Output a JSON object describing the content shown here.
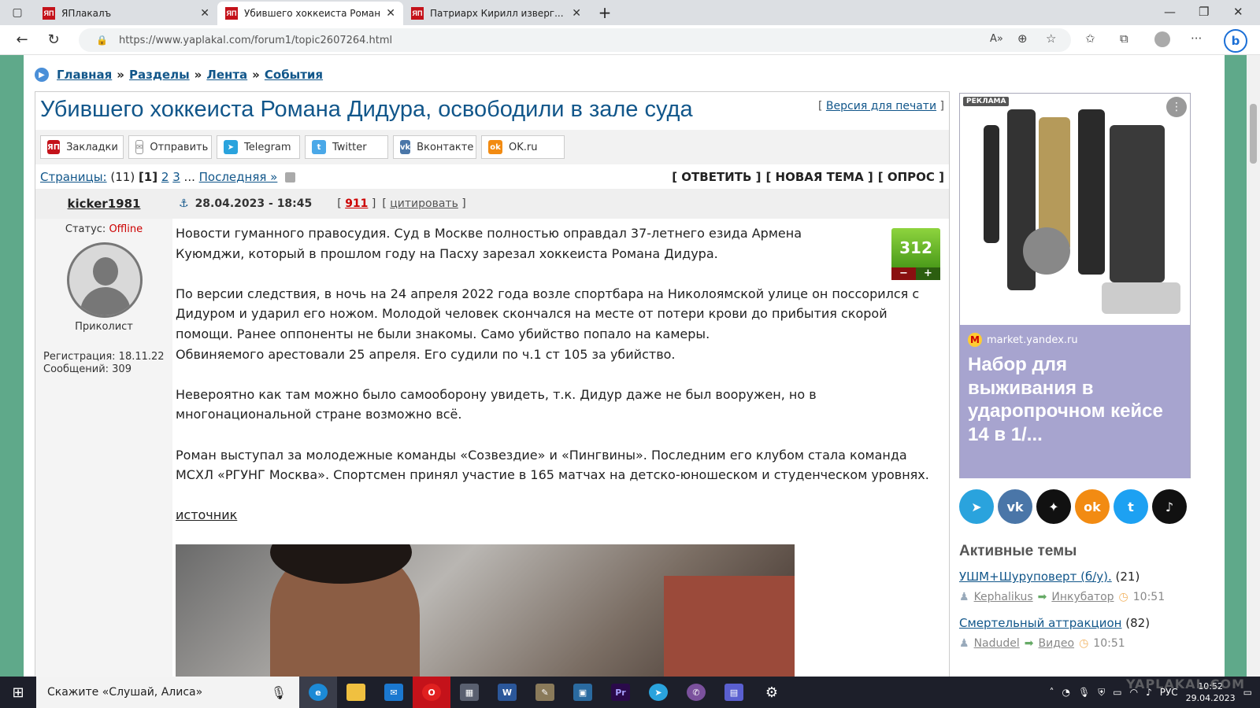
{
  "browser": {
    "tabs": [
      {
        "label": "ЯПлакалъ"
      },
      {
        "label": "Убившего хоккеиста Романа Ди"
      },
      {
        "label": "Патриарх Кирилл изверг... прот"
      }
    ],
    "url": "https://www.yaplakal.com/forum1/topic2607264.html"
  },
  "breadcrumbs": {
    "home": "Главная",
    "sections": "Разделы",
    "feed": "Лента",
    "events": "События",
    "sep": "»"
  },
  "topic": {
    "title": "Убившего хоккеиста Романа Дидура, освободили в зале суда",
    "print_version": "Версия для печати"
  },
  "share": {
    "bookmarks": "Закладки",
    "send": "Отправить",
    "telegram": "Telegram",
    "twitter": "Twitter",
    "vk": "Вконтакте",
    "ok": "OK.ru"
  },
  "pagination": {
    "label": "Страницы:",
    "count": "(11)",
    "current": "[1]",
    "p2": "2",
    "p3": "3",
    "ellipsis": "...",
    "last": "Последняя »"
  },
  "actions": {
    "reply": "[ ОТВЕТИТЬ ]",
    "new_topic": "[ НОВАЯ ТЕМА ]",
    "poll": "[ ОПРОС ]"
  },
  "post": {
    "author": "kicker1981",
    "datetime": "28.04.2023 - 18:45",
    "number": "911",
    "quote": "цитировать",
    "status_label": "Статус:",
    "status_value": "Offline",
    "rank": "Приколист",
    "registration": "Регистрация: 18.11.22",
    "messages": "Сообщений: 309",
    "rating": "312",
    "minus": "−",
    "plus": "+",
    "p1": "Новости гуманного правосудия. Суд в Москве полностью оправдал 37-летнего езида Армена Куюмджи, который в прошлом году на Пасху зарезал хоккеиста Романа Дидура.",
    "p2a": "По версии следствия, в ночь на 24 апреля 2022 года возле спортбара на Николоямской улице он поссорился с Дидуром и ударил его ножом. Молодой человек скончался на месте от потери крови до прибытия скорой помощи. Ранее оппоненты не были знакомы. Само убийство попало на камеры.",
    "p2b": "Обвиняемого арестовали 25 апреля. Его судили по ч.1 ст 105 за убийство.",
    "p3": "Невероятно как там можно было самооборону увидеть, т.к. Дидур даже не был вооружен, но в многонациональной стране возможно всё.",
    "p4": "Роман выступал за молодежные команды «Созвездие» и «Пингвины». Последним его клубом стала команда МСХЛ «РГУНГ Москва». Спортсмен принял участие в 165 матчах на детско-юношеском и студенческом уровнях.",
    "source": "источник"
  },
  "ad": {
    "label": "РЕКЛАМА",
    "source": "market.yandex.ru",
    "headline": "Набор для выживания в ударопрочном кейсе 14 в 1/..."
  },
  "socials": [
    {
      "icon": "telegram-icon",
      "color": "#2aa3dd"
    },
    {
      "icon": "vk-icon",
      "color": "#4a76a8"
    },
    {
      "icon": "zen-icon",
      "color": "#111111"
    },
    {
      "icon": "ok-icon",
      "color": "#f28b12"
    },
    {
      "icon": "twitter-icon",
      "color": "#1da1f2"
    },
    {
      "icon": "tiktok-icon",
      "color": "#111111"
    }
  ],
  "active": {
    "heading": "Активные темы",
    "topics": [
      {
        "title": "УШМ+Шуруповерт (б/у).",
        "count": "(21)",
        "user": "Kephalikus",
        "section": "Инкубатор",
        "time": "10:51"
      },
      {
        "title": "Смертельный аттракцион",
        "count": "(82)",
        "user": "Nadudel",
        "section": "Видео",
        "time": "10:51"
      }
    ]
  },
  "taskbar": {
    "search": "Скажите «Слушай, Алиса»",
    "lang": "РУС",
    "time": "10:52",
    "date": "29.04.2023"
  },
  "watermark": "YAPLAKAL.COM"
}
